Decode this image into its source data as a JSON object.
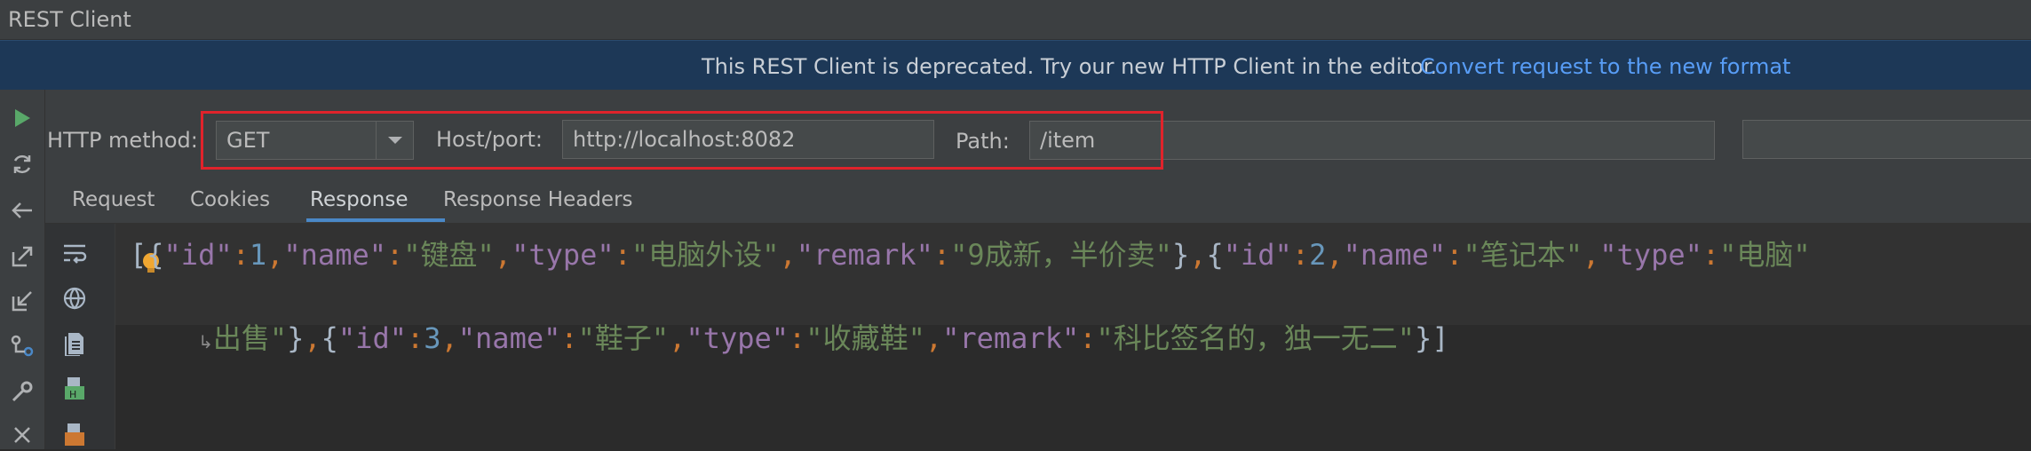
{
  "window": {
    "title": "REST Client"
  },
  "banner": {
    "message": "This REST Client is deprecated. Try our new HTTP Client in the editor.",
    "link": "Convert request to the new format"
  },
  "left_toolbar": {
    "icons": [
      "run-icon",
      "refresh-icon",
      "back-icon",
      "export-icon",
      "import-icon",
      "share-icon",
      "settings-wrench-icon",
      "close-icon"
    ]
  },
  "toolbar": {
    "http_method_label": "HTTP method:",
    "http_method_value": "GET",
    "host_label": "Host/port:",
    "host_value": "http://localhost:8082",
    "path_label": "Path:",
    "path_value": "/item"
  },
  "tabs": [
    {
      "label": "Request",
      "active": false
    },
    {
      "label": "Cookies",
      "active": false
    },
    {
      "label": "Response",
      "active": true
    },
    {
      "label": "Response Headers",
      "active": false
    }
  ],
  "response": {
    "line1": "[{\"id\":1,\"name\":\"键盘\",\"type\":\"电脑外设\",\"remark\":\"9成新，半价卖\"},{\"id\":2,\"name\":\"笔记本\",\"type\":\"电脑\"",
    "line2": "出售\"},{\"id\":3,\"name\":\"鞋子\",\"type\":\"收藏鞋\",\"remark\":\"科比签名的，独一无二\"}]"
  },
  "colors": {
    "highlight_box": "#e0232b",
    "link": "#589df6",
    "banner_bg": "#1d3857",
    "run_icon": "#59a869"
  }
}
